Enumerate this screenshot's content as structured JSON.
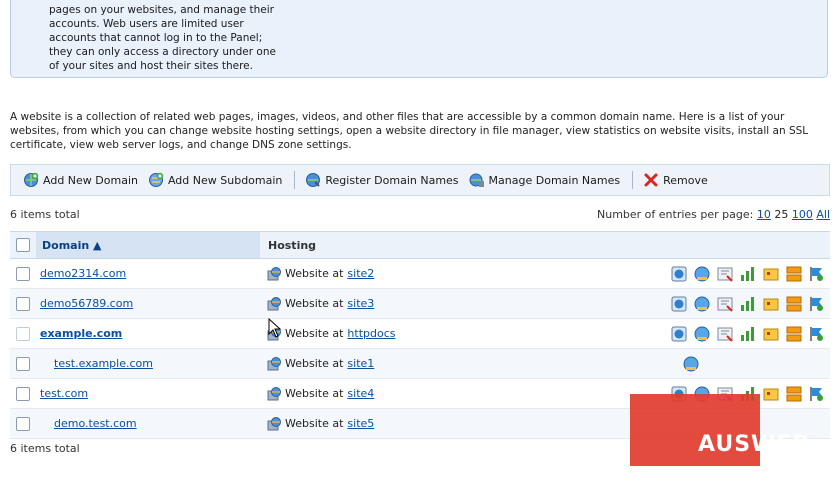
{
  "info": {
    "lines": [
      "pages on your websites, and manage their",
      "accounts. Web users are limited user",
      "accounts that cannot log in to the Panel;",
      "they can only access a directory under one",
      "of your sites and host their sites there."
    ]
  },
  "description": "A website is a collection of related web pages, images, videos, and other files that are accessible by a common domain name. Here is a list of your websites, from which you can change website hosting settings, open a website directory in file manager, view statistics on website visits, install an SSL certificate, view web server logs, and change DNS zone settings.",
  "toolbar": {
    "add_domain": "Add New Domain",
    "add_subdomain": "Add New Subdomain",
    "register": "Register Domain Names",
    "manage": "Manage Domain Names",
    "remove": "Remove"
  },
  "items_total": "6 items total",
  "per_page": {
    "label": "Number of entries per page:",
    "opt10": "10",
    "opt25": "25",
    "opt100": "100",
    "all": "All"
  },
  "table": {
    "col_domain": "Domain ▲",
    "col_hosting": "Hosting",
    "rows": [
      {
        "domain": "demo2314.com",
        "hosting_prefix": "Website at",
        "hosting_link": "site2"
      },
      {
        "domain": "demo56789.com",
        "hosting_prefix": "Website at",
        "hosting_link": "site3"
      },
      {
        "domain": "example.com",
        "hosting_prefix": "Website at",
        "hosting_link": "httpdocs"
      },
      {
        "domain": "test.example.com",
        "hosting_prefix": "Website at",
        "hosting_link": "site1"
      },
      {
        "domain": "test.com",
        "hosting_prefix": "Website at",
        "hosting_link": "site4"
      },
      {
        "domain": "demo.test.com",
        "hosting_prefix": "Website at",
        "hosting_link": "site5"
      }
    ]
  },
  "footer": {
    "items_total": "6 items total"
  },
  "watermark": {
    "text": "AUSWEB",
    "color": "#e03c2e"
  }
}
